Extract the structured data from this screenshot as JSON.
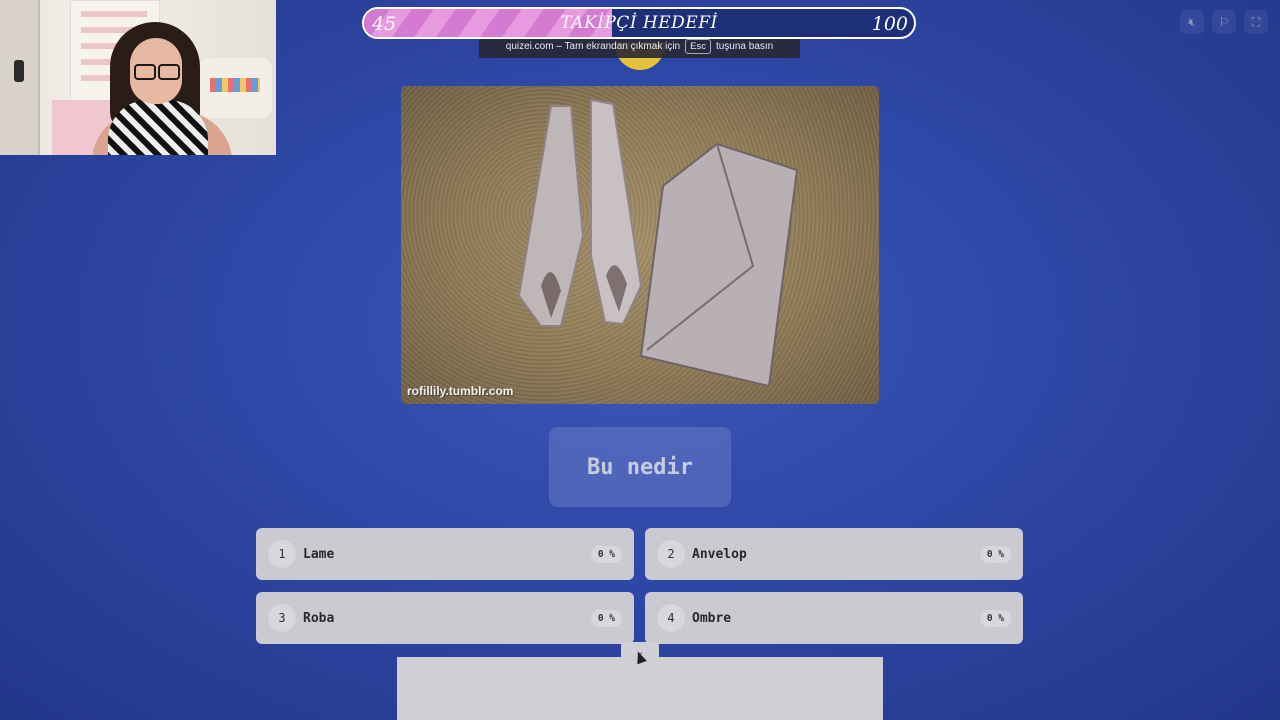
{
  "goal": {
    "title": "TAKİPÇİ HEDEFİ",
    "current": "45",
    "target": "100",
    "progress": 0.45
  },
  "fullscreen_notice": {
    "prefix": "quizei.com – Tam ekrandan çıkmak için",
    "key": "Esc",
    "suffix": "tuşuna basın"
  },
  "controls": {
    "mute_icon": "mute-icon",
    "flag_icon": "flag-icon",
    "fullscreen_icon": "exit-fullscreen-icon"
  },
  "image": {
    "credit": "rofillily.tumblr.com"
  },
  "question": {
    "text": "Bu nedir"
  },
  "answers": [
    {
      "number": "1",
      "label": "Lame",
      "percent": "0 %"
    },
    {
      "number": "2",
      "label": "Anvelop",
      "percent": "0 %"
    },
    {
      "number": "3",
      "label": "Roba",
      "percent": "0 %"
    },
    {
      "number": "4",
      "label": "Ombre",
      "percent": "0 %"
    }
  ],
  "colors": {
    "background": "#2f47a6",
    "progress_fill": "#e89ae0",
    "answer_bg": "#c9cbd0"
  }
}
